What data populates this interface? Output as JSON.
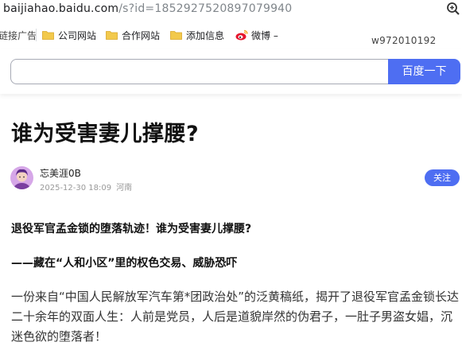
{
  "browser": {
    "url_host": "baijiahao.baidu.com",
    "url_path": "/s?id=1852927520897079940",
    "zoom_icon": "zoom-in-icon"
  },
  "bookmarks": {
    "first_label": "链接广告",
    "items": [
      {
        "label": "公司网站",
        "icon": "folder-icon"
      },
      {
        "label": "合作网站",
        "icon": "folder-icon"
      },
      {
        "label": "添加信息",
        "icon": "folder-icon"
      },
      {
        "label": "微博 –",
        "icon": "weibo-icon"
      }
    ]
  },
  "user_tag": "w972010192",
  "search": {
    "value": "",
    "button_label": "百度一下"
  },
  "article": {
    "title": "谁为受害妻儿撑腰?",
    "author": "忘美涯0B",
    "date": "2025-12-30 18:09",
    "location": "河南",
    "follow_label": "关注",
    "paragraphs": [
      "退役军官孟金锁的堕落轨迹！谁为受害妻儿撑腰?",
      "——藏在“人和小区”里的权色交易、威胁恐吓",
      "一份来自“中国人民解放军汽车第*团政治处”的泛黄稿纸，揭开了退役军官孟金锁长达二十余年的双面人生：人前是党员，人后是道貌岸然的伪君子，一肚子男盗女娼，沉迷色欲的堕落者！"
    ]
  },
  "colors": {
    "accent": "#4e6ef2",
    "url_path": "#80868b",
    "meta": "#999999"
  }
}
